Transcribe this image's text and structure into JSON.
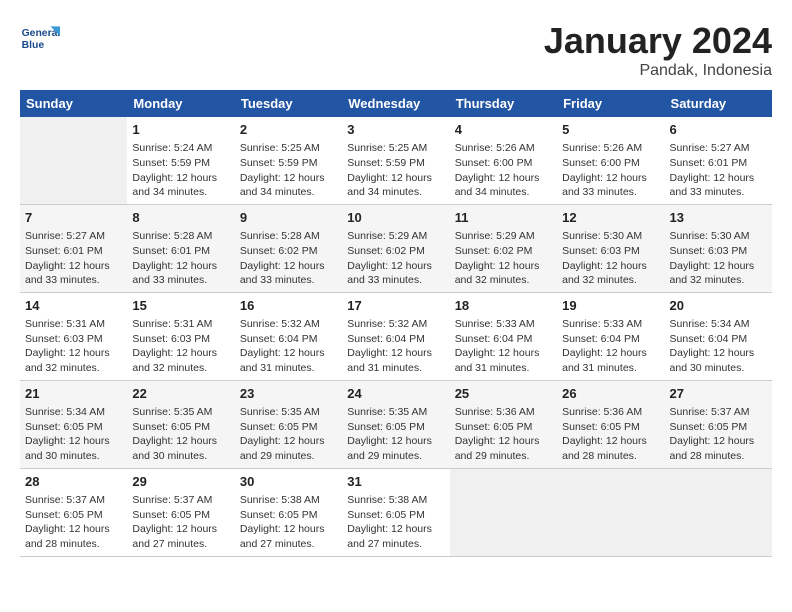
{
  "header": {
    "logo_line1": "General",
    "logo_line2": "Blue",
    "title": "January 2024",
    "subtitle": "Pandak, Indonesia"
  },
  "calendar": {
    "days_of_week": [
      "Sunday",
      "Monday",
      "Tuesday",
      "Wednesday",
      "Thursday",
      "Friday",
      "Saturday"
    ],
    "weeks": [
      [
        {
          "day": "",
          "detail": ""
        },
        {
          "day": "1",
          "detail": "Sunrise: 5:24 AM\nSunset: 5:59 PM\nDaylight: 12 hours\nand 34 minutes."
        },
        {
          "day": "2",
          "detail": "Sunrise: 5:25 AM\nSunset: 5:59 PM\nDaylight: 12 hours\nand 34 minutes."
        },
        {
          "day": "3",
          "detail": "Sunrise: 5:25 AM\nSunset: 5:59 PM\nDaylight: 12 hours\nand 34 minutes."
        },
        {
          "day": "4",
          "detail": "Sunrise: 5:26 AM\nSunset: 6:00 PM\nDaylight: 12 hours\nand 34 minutes."
        },
        {
          "day": "5",
          "detail": "Sunrise: 5:26 AM\nSunset: 6:00 PM\nDaylight: 12 hours\nand 33 minutes."
        },
        {
          "day": "6",
          "detail": "Sunrise: 5:27 AM\nSunset: 6:01 PM\nDaylight: 12 hours\nand 33 minutes."
        }
      ],
      [
        {
          "day": "7",
          "detail": "Sunrise: 5:27 AM\nSunset: 6:01 PM\nDaylight: 12 hours\nand 33 minutes."
        },
        {
          "day": "8",
          "detail": "Sunrise: 5:28 AM\nSunset: 6:01 PM\nDaylight: 12 hours\nand 33 minutes."
        },
        {
          "day": "9",
          "detail": "Sunrise: 5:28 AM\nSunset: 6:02 PM\nDaylight: 12 hours\nand 33 minutes."
        },
        {
          "day": "10",
          "detail": "Sunrise: 5:29 AM\nSunset: 6:02 PM\nDaylight: 12 hours\nand 33 minutes."
        },
        {
          "day": "11",
          "detail": "Sunrise: 5:29 AM\nSunset: 6:02 PM\nDaylight: 12 hours\nand 32 minutes."
        },
        {
          "day": "12",
          "detail": "Sunrise: 5:30 AM\nSunset: 6:03 PM\nDaylight: 12 hours\nand 32 minutes."
        },
        {
          "day": "13",
          "detail": "Sunrise: 5:30 AM\nSunset: 6:03 PM\nDaylight: 12 hours\nand 32 minutes."
        }
      ],
      [
        {
          "day": "14",
          "detail": "Sunrise: 5:31 AM\nSunset: 6:03 PM\nDaylight: 12 hours\nand 32 minutes."
        },
        {
          "day": "15",
          "detail": "Sunrise: 5:31 AM\nSunset: 6:03 PM\nDaylight: 12 hours\nand 32 minutes."
        },
        {
          "day": "16",
          "detail": "Sunrise: 5:32 AM\nSunset: 6:04 PM\nDaylight: 12 hours\nand 31 minutes."
        },
        {
          "day": "17",
          "detail": "Sunrise: 5:32 AM\nSunset: 6:04 PM\nDaylight: 12 hours\nand 31 minutes."
        },
        {
          "day": "18",
          "detail": "Sunrise: 5:33 AM\nSunset: 6:04 PM\nDaylight: 12 hours\nand 31 minutes."
        },
        {
          "day": "19",
          "detail": "Sunrise: 5:33 AM\nSunset: 6:04 PM\nDaylight: 12 hours\nand 31 minutes."
        },
        {
          "day": "20",
          "detail": "Sunrise: 5:34 AM\nSunset: 6:04 PM\nDaylight: 12 hours\nand 30 minutes."
        }
      ],
      [
        {
          "day": "21",
          "detail": "Sunrise: 5:34 AM\nSunset: 6:05 PM\nDaylight: 12 hours\nand 30 minutes."
        },
        {
          "day": "22",
          "detail": "Sunrise: 5:35 AM\nSunset: 6:05 PM\nDaylight: 12 hours\nand 30 minutes."
        },
        {
          "day": "23",
          "detail": "Sunrise: 5:35 AM\nSunset: 6:05 PM\nDaylight: 12 hours\nand 29 minutes."
        },
        {
          "day": "24",
          "detail": "Sunrise: 5:35 AM\nSunset: 6:05 PM\nDaylight: 12 hours\nand 29 minutes."
        },
        {
          "day": "25",
          "detail": "Sunrise: 5:36 AM\nSunset: 6:05 PM\nDaylight: 12 hours\nand 29 minutes."
        },
        {
          "day": "26",
          "detail": "Sunrise: 5:36 AM\nSunset: 6:05 PM\nDaylight: 12 hours\nand 28 minutes."
        },
        {
          "day": "27",
          "detail": "Sunrise: 5:37 AM\nSunset: 6:05 PM\nDaylight: 12 hours\nand 28 minutes."
        }
      ],
      [
        {
          "day": "28",
          "detail": "Sunrise: 5:37 AM\nSunset: 6:05 PM\nDaylight: 12 hours\nand 28 minutes."
        },
        {
          "day": "29",
          "detail": "Sunrise: 5:37 AM\nSunset: 6:05 PM\nDaylight: 12 hours\nand 27 minutes."
        },
        {
          "day": "30",
          "detail": "Sunrise: 5:38 AM\nSunset: 6:05 PM\nDaylight: 12 hours\nand 27 minutes."
        },
        {
          "day": "31",
          "detail": "Sunrise: 5:38 AM\nSunset: 6:05 PM\nDaylight: 12 hours\nand 27 minutes."
        },
        {
          "day": "",
          "detail": ""
        },
        {
          "day": "",
          "detail": ""
        },
        {
          "day": "",
          "detail": ""
        }
      ]
    ]
  }
}
